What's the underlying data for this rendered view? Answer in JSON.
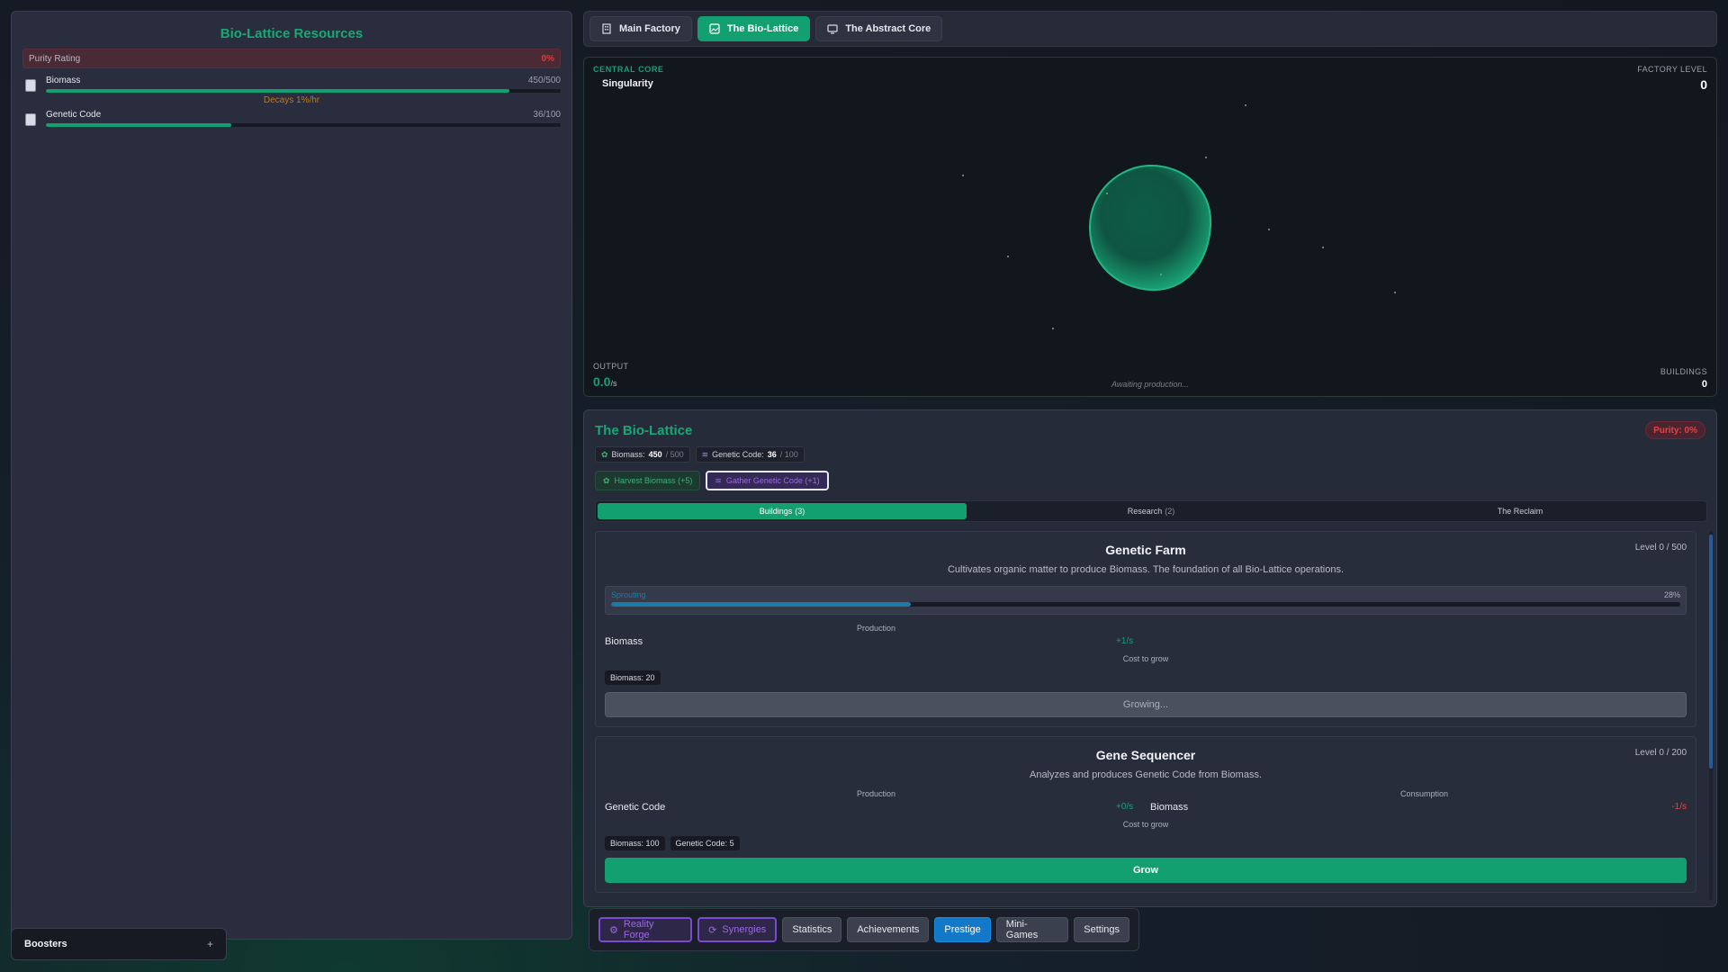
{
  "left": {
    "title": "Bio-Lattice Resources",
    "purity_label": "Purity Rating",
    "purity_value": "0%",
    "resources": [
      {
        "name": "Biomass",
        "value": "450/500",
        "fill": 0.9,
        "note": "Decays 1%/hr"
      },
      {
        "name": "Genetic Code",
        "value": "36/100",
        "fill": 0.36
      }
    ]
  },
  "boosters": {
    "label": "Boosters",
    "toggle": "+"
  },
  "top_tabs": [
    {
      "label": "Main Factory",
      "icon": "building-icon"
    },
    {
      "label": "The Bio-Lattice",
      "icon": "image-icon",
      "active": true
    },
    {
      "label": "The Abstract Core",
      "icon": "monitor-icon"
    }
  ],
  "core": {
    "label": "CENTRAL CORE",
    "name": "Singularity",
    "factory_level_label": "FACTORY LEVEL",
    "factory_level": "0",
    "output_label": "OUTPUT",
    "output_value": "0.0",
    "output_unit": "/s",
    "awaiting": "Awaiting production...",
    "buildings_label": "BUILDINGS",
    "buildings_value": "0"
  },
  "bio": {
    "title": "The Bio-Lattice",
    "purity": "Purity: 0%",
    "chips": [
      {
        "icon": "leaf-icon",
        "label": "Biomass:",
        "value": "450",
        "cap": "/ 500"
      },
      {
        "icon": "dna-icon",
        "label": "Genetic Code:",
        "value": "36",
        "cap": "/ 100"
      }
    ],
    "actions": [
      {
        "icon": "leaf-icon",
        "label": "Harvest Biomass (+5)"
      },
      {
        "icon": "dna-icon",
        "label": "Gather Genetic Code (+1)"
      }
    ],
    "subtabs": [
      {
        "label": "Buildings",
        "count": "(3)",
        "active": true
      },
      {
        "label": "Research",
        "count": "(2)"
      },
      {
        "label": "The Reclaim",
        "count": ""
      }
    ],
    "cards": [
      {
        "title": "Genetic Farm",
        "level": "Level 0 / 500",
        "desc": "Cultivates organic matter to produce Biomass. The foundation of all Bio-Lattice operations.",
        "grow_label": "Sprouting",
        "grow_pct": "28%",
        "grow_fill": 0.28,
        "production_head": "Production",
        "prod_name": "Biomass",
        "prod_rate": "+1/s",
        "cost_head": "Cost to grow",
        "costs": [
          "Biomass: 20"
        ],
        "button": "Growing..."
      },
      {
        "title": "Gene Sequencer",
        "level": "Level 0 / 200",
        "desc": "Analyzes and produces Genetic Code from Biomass.",
        "production_head": "Production",
        "prod_name": "Genetic Code",
        "prod_rate": "+0/s",
        "consumption_head": "Consumption",
        "cons_name": "Biomass",
        "cons_rate": "-1/s",
        "cost_head": "Cost to grow",
        "costs": [
          "Biomass: 100",
          "Genetic Code: 5"
        ],
        "button": "Grow"
      }
    ]
  },
  "bottom_nav": [
    {
      "label": "Reality Forge",
      "icon": "gear-icon",
      "style": "purple"
    },
    {
      "label": "Synergies",
      "icon": "cycle-icon",
      "style": "purple"
    },
    {
      "label": "Statistics",
      "style": "gray"
    },
    {
      "label": "Achievements",
      "style": "gray"
    },
    {
      "label": "Prestige",
      "style": "blue"
    },
    {
      "label": "Mini-Games",
      "style": "gray"
    },
    {
      "label": "Settings",
      "style": "gray"
    }
  ],
  "colors": {
    "accent": "#13a070",
    "danger": "#e04545",
    "purple": "#7a4ad0",
    "blue": "#1478c8"
  }
}
